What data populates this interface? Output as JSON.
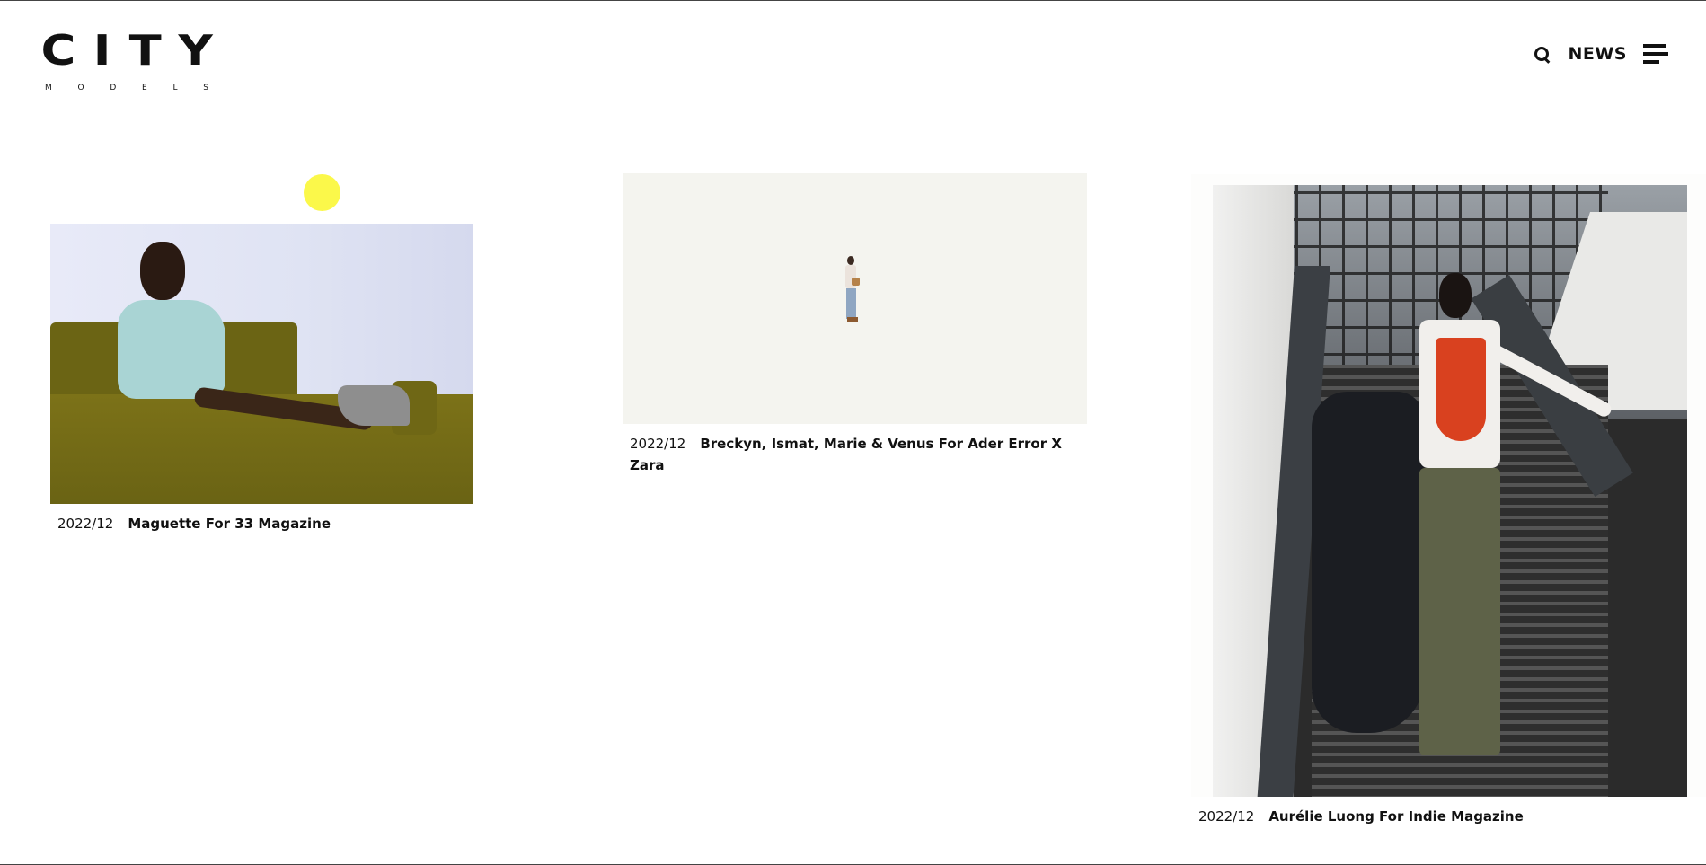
{
  "header": {
    "logo": {
      "word": [
        "C",
        "I",
        "T",
        "Y"
      ],
      "sub": [
        "M",
        "O",
        "D",
        "E",
        "L",
        "S"
      ]
    },
    "search_icon": "search-icon",
    "news_label": "NEWS",
    "menu_icon": "hamburger-icon"
  },
  "articles": [
    {
      "date": "2022/12",
      "title": "Maguette For 33 Magazine"
    },
    {
      "date": "2022/12",
      "title": "Breckyn, Ismat, Marie & Venus For Ader Error X Zara"
    },
    {
      "date": "2022/12",
      "title": "Aurélie Luong For Indie Magazine"
    }
  ],
  "colors": {
    "cursor_dot": "#fbf84a",
    "text": "#111111",
    "background": "#ffffff"
  }
}
